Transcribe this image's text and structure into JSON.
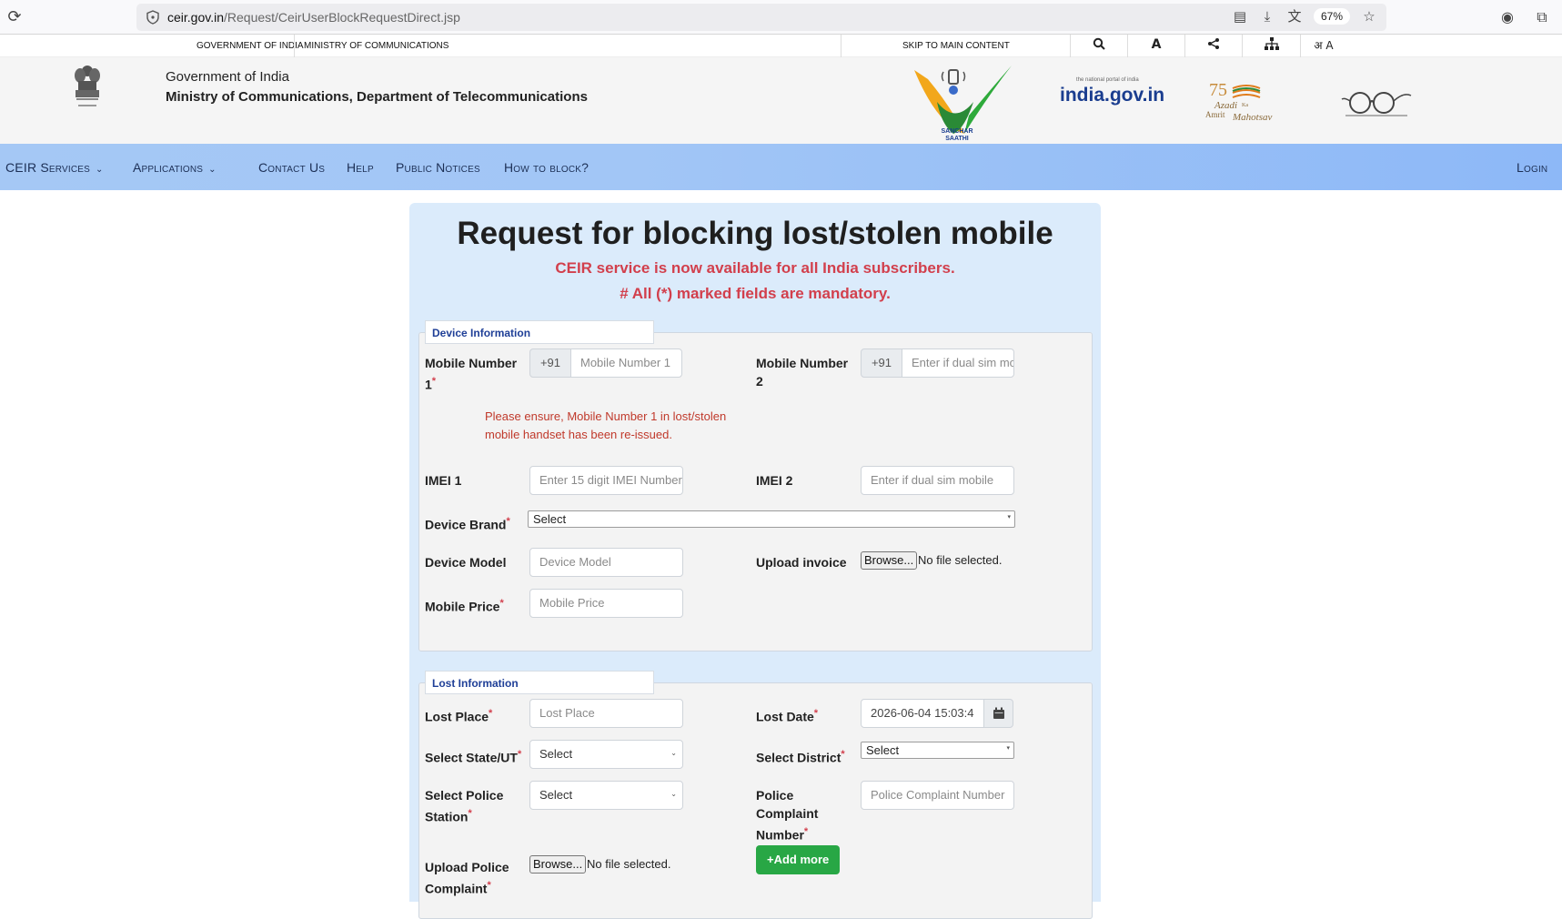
{
  "browser": {
    "url_host": "ceir.gov.in",
    "url_path": "/Request/CeirUserBlockRequestDirect.jsp",
    "zoom": "67%"
  },
  "gov_strip": {
    "gov_link": "GOVERNMENT OF INDIA",
    "ministry_link": "MINISTRY OF COMMUNICATIONS",
    "skip_link": "SKIP TO MAIN CONTENT",
    "font_tool": "A",
    "lang_tool": "अ A"
  },
  "header": {
    "line1": "Government of India",
    "line2": "Ministry of Communications, Department of Telecommunications",
    "sanchar_text": "SANCHAR SAATHI",
    "india_gov": "india.gov.in",
    "india_gov_tag": "the national portal of india",
    "azadi_text": "Azadi Ka Amrit Mahotsav"
  },
  "nav": {
    "items": [
      "CEIR Services",
      "Applications",
      "Contact Us",
      "Help",
      "Public Notices",
      "How to block?"
    ],
    "login": "Login"
  },
  "form": {
    "title": "Request for blocking lost/stolen mobile",
    "notice1": "CEIR service is now available for all India subscribers.",
    "notice2": "# All (*) marked fields are mandatory.",
    "device": {
      "legend": "Device Information",
      "mobile1_label": "Mobile Number 1",
      "mobile1_prefix": "+91",
      "mobile1_placeholder": "Mobile Number 1",
      "mobile2_label": "Mobile Number 2",
      "mobile2_prefix": "+91",
      "mobile2_placeholder": "Enter if dual sim mobile",
      "warning": "Please ensure, Mobile Number 1 in lost/stolen mobile handset has been re-issued.",
      "imei1_label": "IMEI 1",
      "imei1_placeholder": "Enter 15 digit IMEI Number",
      "imei2_label": "IMEI 2",
      "imei2_placeholder": "Enter if dual sim mobile",
      "brand_label": "Device Brand",
      "brand_value": "Select",
      "model_label": "Device Model",
      "model_placeholder": "Device Model",
      "invoice_label": "Upload invoice",
      "browse": "Browse...",
      "no_file": "No file selected.",
      "price_label": "Mobile Price",
      "price_placeholder": "Mobile Price"
    },
    "lost": {
      "legend": "Lost Information",
      "place_label": "Lost Place",
      "place_placeholder": "Lost Place",
      "date_label": "Lost Date",
      "date_value": "2026-06-04 15:03:4",
      "state_label": "Select State/UT",
      "state_value": "Select",
      "district_label": "Select District",
      "district_value": "Select",
      "police_station_label": "Select Police Station",
      "police_station_value": "Select",
      "complaint_label": "Police Complaint Number",
      "complaint_placeholder": "Police Complaint Number",
      "upload_complaint_label": "Upload Police Complaint",
      "browse": "Browse...",
      "no_file": "No file selected.",
      "add_more": "+Add more"
    }
  }
}
